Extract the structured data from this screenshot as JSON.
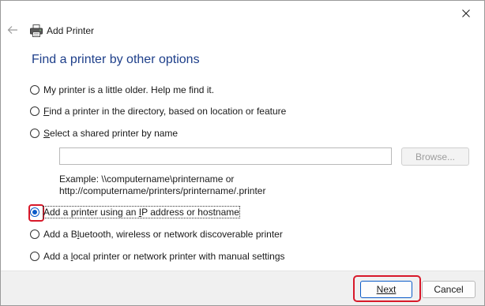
{
  "window": {
    "title": "Add Printer",
    "close_icon": "close-icon",
    "back_icon": "back-arrow-icon",
    "app_icon": "printer-icon"
  },
  "heading": "Find a printer by other options",
  "options": [
    {
      "pre": "",
      "key": "",
      "label": "My printer is a little older. Help me find it.",
      "checked": false
    },
    {
      "pre": "",
      "key": "F",
      "label": "ind a printer in the directory, based on location or feature",
      "checked": false
    },
    {
      "pre": "",
      "key": "S",
      "label": "elect a shared printer by name",
      "checked": false
    },
    {
      "pre": "Add a printer using an ",
      "key": "I",
      "label": "P address or hostname",
      "checked": true
    },
    {
      "pre": "Add a B",
      "key": "l",
      "label": "uetooth, wireless or network discoverable printer",
      "checked": false
    },
    {
      "pre": "Add a ",
      "key": "l",
      "label": "ocal printer or network printer with manual settings",
      "checked": false
    }
  ],
  "shared": {
    "value": "",
    "browse_label": "Browse...",
    "example_line1": "Example: \\\\computername\\printername or",
    "example_line2": "http://computername/printers/printername/.printer"
  },
  "footer": {
    "next_label": "Next",
    "cancel_label": "Cancel"
  },
  "colors": {
    "heading": "#1e3f8a",
    "accent": "#0a5bc8",
    "highlight": "#d8192a"
  }
}
